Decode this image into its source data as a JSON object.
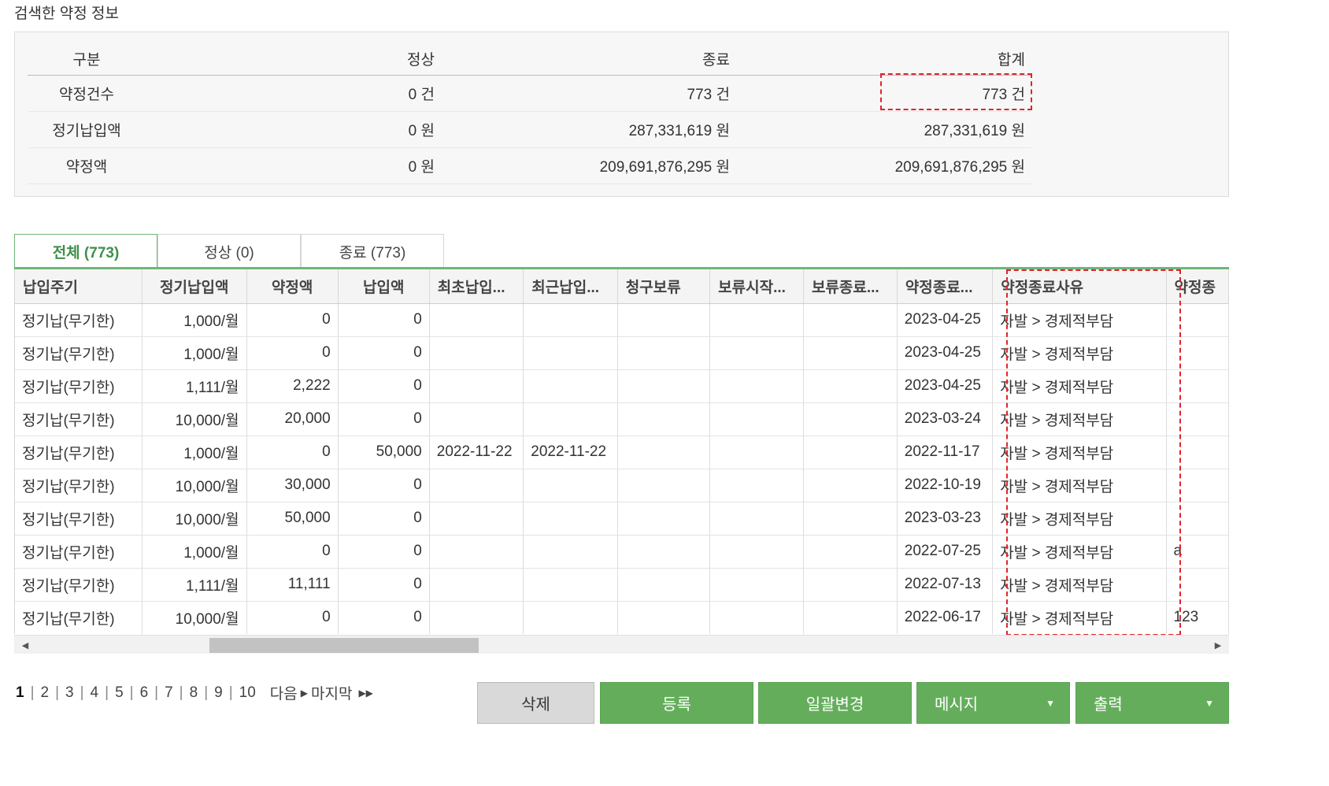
{
  "section_title": "검색한 약정 정보",
  "summary": {
    "headers": {
      "label": "구분",
      "normal": "정상",
      "end": "종료",
      "total": "합계"
    },
    "rows": [
      {
        "label": "약정건수",
        "normal": "0 건",
        "end": "773 건",
        "total": "773 건"
      },
      {
        "label": "정기납입액",
        "normal": "0 원",
        "end": "287,331,619 원",
        "total": "287,331,619 원"
      },
      {
        "label": "약정액",
        "normal": "0 원",
        "end": "209,691,876,295 원",
        "total": "209,691,876,295 원"
      }
    ]
  },
  "tabs": [
    {
      "label": "전체 (773)",
      "active": true
    },
    {
      "label": "정상 (0)",
      "active": false
    },
    {
      "label": "종료 (773)",
      "active": false
    }
  ],
  "grid": {
    "columns": [
      "납입주기",
      "정기납입액",
      "약정액",
      "납입액",
      "최초납입...",
      "최근납입...",
      "청구보류",
      "보류시작...",
      "보류종료...",
      "약정종료...",
      "약정종료사유",
      "약정종"
    ],
    "rows": [
      [
        "정기납(무기한)",
        "1,000/월",
        "0",
        "0",
        "",
        "",
        "",
        "",
        "",
        "2023-04-25",
        "자발 > 경제적부담",
        ""
      ],
      [
        "정기납(무기한)",
        "1,000/월",
        "0",
        "0",
        "",
        "",
        "",
        "",
        "",
        "2023-04-25",
        "자발 > 경제적부담",
        ""
      ],
      [
        "정기납(무기한)",
        "1,111/월",
        "2,222",
        "0",
        "",
        "",
        "",
        "",
        "",
        "2023-04-25",
        "자발 > 경제적부담",
        ""
      ],
      [
        "정기납(무기한)",
        "10,000/월",
        "20,000",
        "0",
        "",
        "",
        "",
        "",
        "",
        "2023-03-24",
        "자발 > 경제적부담",
        ""
      ],
      [
        "정기납(무기한)",
        "1,000/월",
        "0",
        "50,000",
        "2022-11-22",
        "2022-11-22",
        "",
        "",
        "",
        "2022-11-17",
        "자발 > 경제적부담",
        ""
      ],
      [
        "정기납(무기한)",
        "10,000/월",
        "30,000",
        "0",
        "",
        "",
        "",
        "",
        "",
        "2022-10-19",
        "자발 > 경제적부담",
        ""
      ],
      [
        "정기납(무기한)",
        "10,000/월",
        "50,000",
        "0",
        "",
        "",
        "",
        "",
        "",
        "2023-03-23",
        "자발 > 경제적부담",
        ""
      ],
      [
        "정기납(무기한)",
        "1,000/월",
        "0",
        "0",
        "",
        "",
        "",
        "",
        "",
        "2022-07-25",
        "자발 > 경제적부담",
        "a"
      ],
      [
        "정기납(무기한)",
        "1,111/월",
        "11,111",
        "0",
        "",
        "",
        "",
        "",
        "",
        "2022-07-13",
        "자발 > 경제적부담",
        ""
      ],
      [
        "정기납(무기한)",
        "10,000/월",
        "0",
        "0",
        "",
        "",
        "",
        "",
        "",
        "2022-06-17",
        "자발 > 경제적부담",
        "123"
      ]
    ]
  },
  "pagination": {
    "pages": [
      "1",
      "2",
      "3",
      "4",
      "5",
      "6",
      "7",
      "8",
      "9",
      "10"
    ],
    "current": "1",
    "next_label": "다음",
    "last_label": "마지막"
  },
  "buttons": {
    "delete": "삭제",
    "register": "등록",
    "bulk_change": "일괄변경",
    "message": "메시지",
    "print": "출력"
  },
  "colors": {
    "accent_green": "#64ae5b",
    "tab_active_text": "#3e8f4a",
    "highlight_red": "#e0242b"
  }
}
